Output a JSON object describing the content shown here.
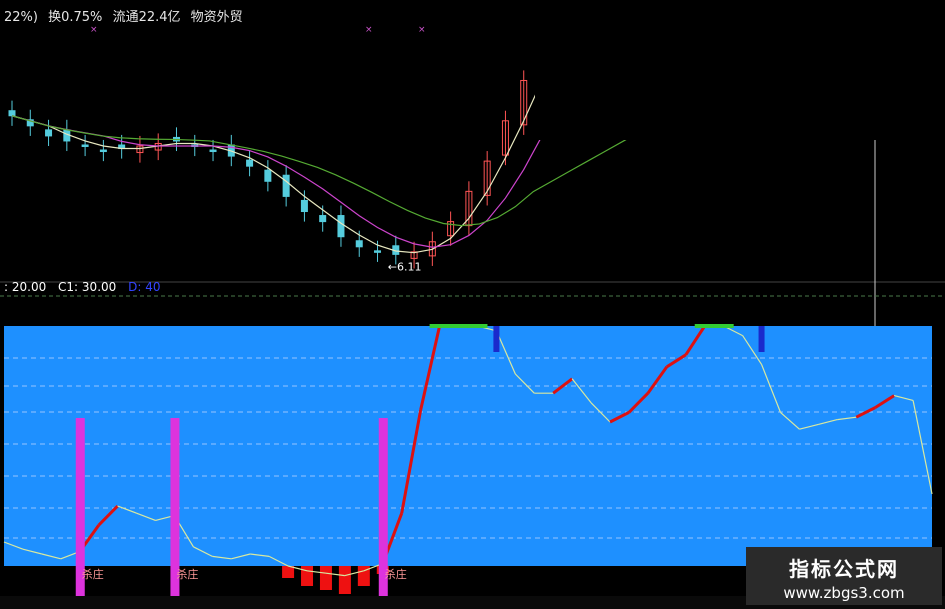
{
  "header": {
    "items": [
      "22%)",
      "换0.75%",
      "流通22.4亿",
      "物资外贸"
    ]
  },
  "indicator_legend": {
    "items": [
      {
        "text": ": 20.00",
        "color": "#ffffff"
      },
      {
        "text": "C1: 30.00",
        "color": "#ffffff"
      },
      {
        "text": "D: 40",
        "color": "#3344ff"
      }
    ]
  },
  "annotations": {
    "low_price": "←6.11",
    "signal_label": "杀庄"
  },
  "watermark": {
    "title": "指标公式网",
    "url": "www.zbgs3.com"
  },
  "colors": {
    "background": "#000000",
    "indicator_panel": "#1e90ff",
    "ma_fast": "#e8e8c0",
    "ma_mid": "#cc44cc",
    "ma_slow": "#55aa33",
    "signal_bar": "#dd33dd",
    "curve_normal": "#d8e8a0",
    "curve_rising": "#dd1111",
    "top_marker": "#33cc33",
    "bottom_fill": "#ee1111",
    "candle_up": "#ff5555",
    "candle_down": "#55ccdd"
  },
  "chart_data": [
    {
      "type": "candlestick",
      "title": "",
      "series": [
        {
          "name": "",
          "values": [
            8.9,
            8.7,
            8.5,
            8.4,
            8.3,
            8.2,
            8.25,
            8.3,
            8.35,
            8.4,
            8.3,
            8.2,
            8.1,
            7.9,
            7.6,
            7.3,
            7.0,
            6.8,
            6.5,
            6.3,
            6.2,
            6.15,
            6.2,
            6.4,
            6.8,
            7.4,
            8.0,
            8.8,
            9.6,
            10.4
          ]
        }
      ],
      "low_label_value": 6.11
    },
    {
      "type": "line",
      "title": "",
      "ylim": [
        0,
        100
      ],
      "levels": [
        20,
        30,
        40
      ],
      "series": [
        {
          "name": "",
          "values": [
            10,
            7,
            5,
            3,
            6,
            17,
            25,
            22,
            19,
            21,
            8,
            4,
            3,
            5,
            4,
            0,
            -2,
            -3,
            -4,
            -2,
            1,
            22,
            65,
            100,
            100,
            100,
            98,
            80,
            72,
            72,
            78,
            68,
            60,
            64,
            72,
            83,
            88,
            100,
            100,
            96,
            84,
            64,
            57,
            59,
            61,
            62,
            66,
            71,
            69,
            30
          ]
        }
      ],
      "signals": [
        {
          "index": 4,
          "label": "杀庄"
        },
        {
          "index": 9,
          "label": "杀庄"
        },
        {
          "index": 20,
          "label": "杀庄"
        }
      ]
    }
  ]
}
